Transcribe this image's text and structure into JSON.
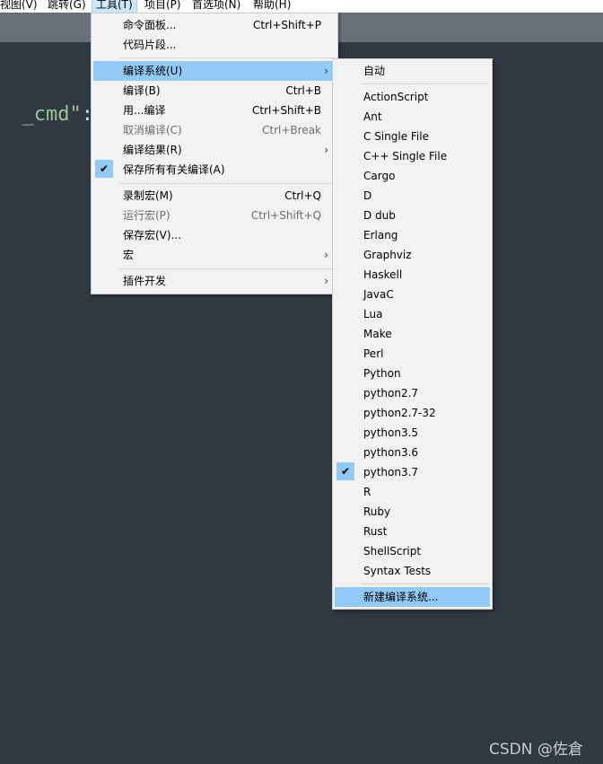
{
  "menubar": {
    "items": [
      {
        "label": "视图(V)"
      },
      {
        "label": "跳转(G)"
      },
      {
        "label": "工具(T)"
      },
      {
        "label": "项目(P)"
      },
      {
        "label": "首选项(N)"
      },
      {
        "label": "帮助(H)"
      }
    ]
  },
  "editor": {
    "code_string": "_cmd\"",
    "code_punct": ":"
  },
  "tools_menu": {
    "items": [
      {
        "label": "命令面板...",
        "shortcut": "Ctrl+Shift+P"
      },
      {
        "label": "代码片段..."
      },
      {
        "label": "编译系统(U)",
        "submenu": "›"
      },
      {
        "label": "编译(B)",
        "shortcut": "Ctrl+B"
      },
      {
        "label": "用...编译",
        "shortcut": "Ctrl+Shift+B"
      },
      {
        "label": "取消编译(C)",
        "shortcut": "Ctrl+Break"
      },
      {
        "label": "编译结果(R)",
        "submenu": "›"
      },
      {
        "label": "保存所有有关编译(A)",
        "check": "✔"
      },
      {
        "label": "录制宏(M)",
        "shortcut": "Ctrl+Q"
      },
      {
        "label": "运行宏(P)",
        "shortcut": "Ctrl+Shift+Q"
      },
      {
        "label": "保存宏(V)..."
      },
      {
        "label": "宏",
        "submenu": "›"
      },
      {
        "label": "插件开发",
        "submenu": "›"
      }
    ]
  },
  "build_system_menu": {
    "items": [
      {
        "label": "自动"
      },
      {
        "label": "ActionScript"
      },
      {
        "label": "Ant"
      },
      {
        "label": "C Single File"
      },
      {
        "label": "C++ Single File"
      },
      {
        "label": "Cargo"
      },
      {
        "label": "D"
      },
      {
        "label": "D dub"
      },
      {
        "label": "Erlang"
      },
      {
        "label": "Graphviz"
      },
      {
        "label": "Haskell"
      },
      {
        "label": "JavaC"
      },
      {
        "label": "Lua"
      },
      {
        "label": "Make"
      },
      {
        "label": "Perl"
      },
      {
        "label": "Python"
      },
      {
        "label": "python2.7"
      },
      {
        "label": "python2.7-32"
      },
      {
        "label": "python3.5"
      },
      {
        "label": "python3.6"
      },
      {
        "label": "python3.7",
        "check": "✔"
      },
      {
        "label": "R"
      },
      {
        "label": "Ruby"
      },
      {
        "label": "Rust"
      },
      {
        "label": "ShellScript"
      },
      {
        "label": "Syntax Tests"
      },
      {
        "label": "新建编译系统..."
      }
    ]
  },
  "watermark": "CSDN @佐倉",
  "colors": {
    "background": "#303841",
    "highlight": "#91c9f7",
    "string": "#99c794"
  }
}
